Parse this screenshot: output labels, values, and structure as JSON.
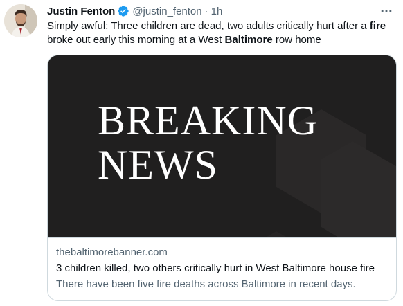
{
  "author": {
    "display_name": "Justin Fenton",
    "handle": "@justin_fenton",
    "separator": "·",
    "time": "1h",
    "verified": true
  },
  "tweet": {
    "segments": [
      "Simply awful: Three children are dead, two adults critically hurt after a ",
      "fire",
      " broke out early this morning at a West ",
      "Baltimore",
      " row home"
    ]
  },
  "card": {
    "image_text_line1": "BREAKING",
    "image_text_line2": "NEWS",
    "domain": "thebaltimorebanner.com",
    "title": "3 children killed, two others critically hurt in West Baltimore house fire",
    "description": "There have been five fire deaths across Baltimore in recent days."
  },
  "icons": {
    "verified": "verified-badge-icon",
    "more": "more-options-icon"
  },
  "colors": {
    "verified_blue": "#1d9bf0",
    "secondary_text": "#536471",
    "card_border": "#cfd9de",
    "card_image_bg": "#201f1f"
  }
}
